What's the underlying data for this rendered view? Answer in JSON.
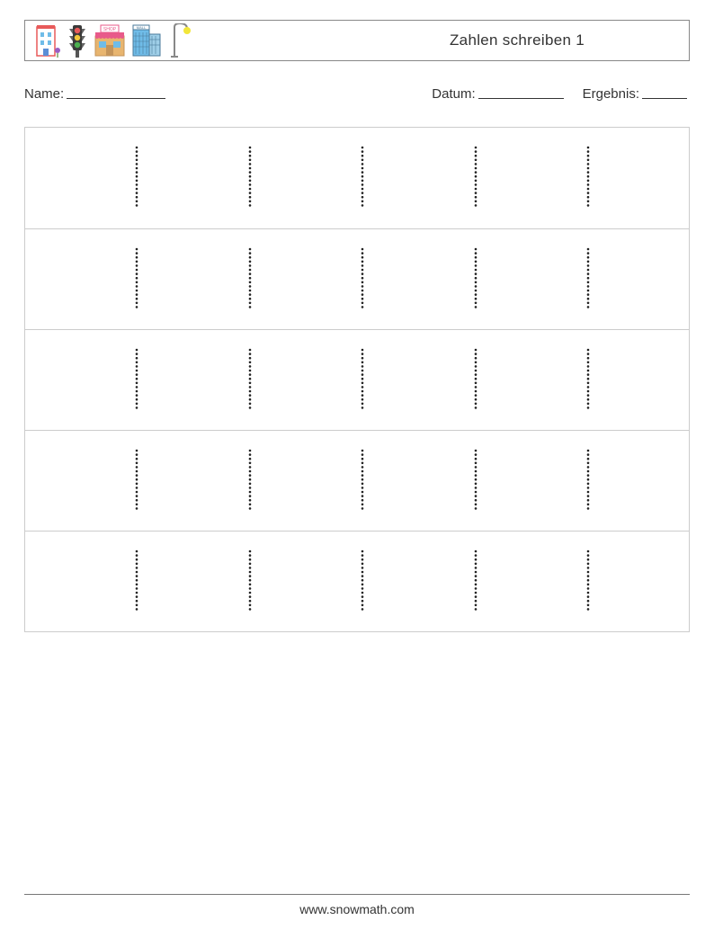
{
  "header": {
    "title": "Zahlen schreiben 1"
  },
  "info": {
    "name_label": "Name:",
    "date_label": "Datum:",
    "result_label": "Ergebnis:"
  },
  "grid": {
    "rows": 5,
    "cols": 5
  },
  "footer": {
    "url": "www.snowmath.com"
  }
}
